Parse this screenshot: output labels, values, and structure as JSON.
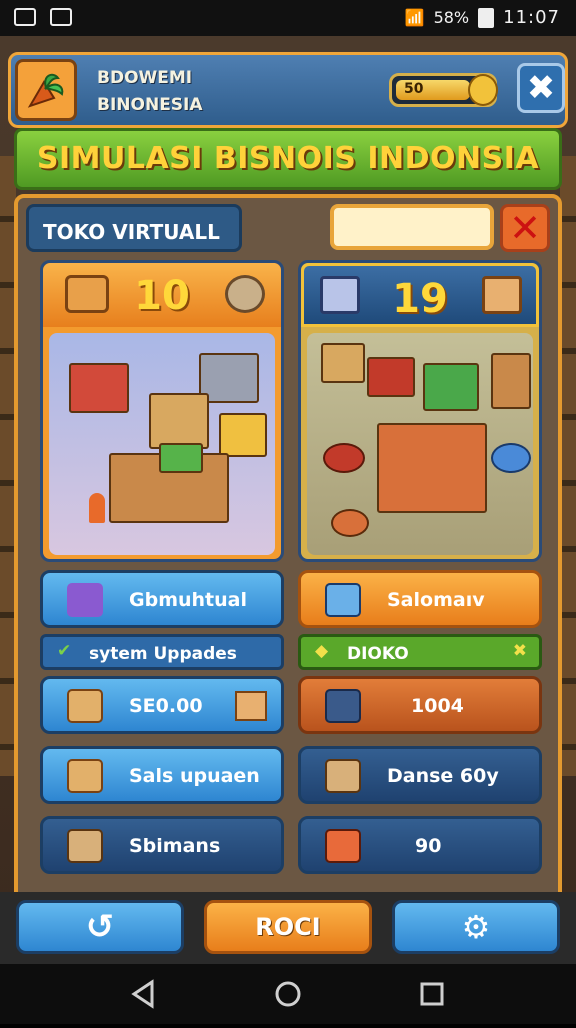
{
  "status_bar": {
    "battery": "58%",
    "time": "11:07"
  },
  "header": {
    "app_name_line1": "BDOWEMI",
    "app_name_line2": "BINONESIA",
    "coin_value": "50"
  },
  "title": "SIMULASI BISNOIS INDONSIA",
  "panel": {
    "tab_label": "TOKO VIRTUALL",
    "search_value": "",
    "card_left": {
      "count": "10"
    },
    "card_right": {
      "count": "19"
    },
    "left_buttons": [
      {
        "label": "Gbmuhtual",
        "color": "blue"
      },
      {
        "label": "sytem Uppades",
        "color": "navy"
      },
      {
        "label": "SE0.00",
        "color": "blue"
      },
      {
        "label": "Sals upuaen",
        "color": "blue"
      },
      {
        "label": "Sbimans",
        "color": "navy"
      }
    ],
    "right_buttons": [
      {
        "label": "Salomaıv",
        "color": "orange"
      },
      {
        "label": "DIOKO",
        "color": "green"
      },
      {
        "label": "1004",
        "color": "rust"
      },
      {
        "label": "Danse 60y",
        "color": "navy"
      },
      {
        "label": "90",
        "color": "navy"
      }
    ]
  },
  "bottom_bar": {
    "center_label": "ROCI"
  },
  "colors": {
    "accent_orange": "#f39b2e",
    "accent_green": "#6abf2f",
    "accent_blue": "#2e86d1",
    "gold": "#ffd83a"
  }
}
